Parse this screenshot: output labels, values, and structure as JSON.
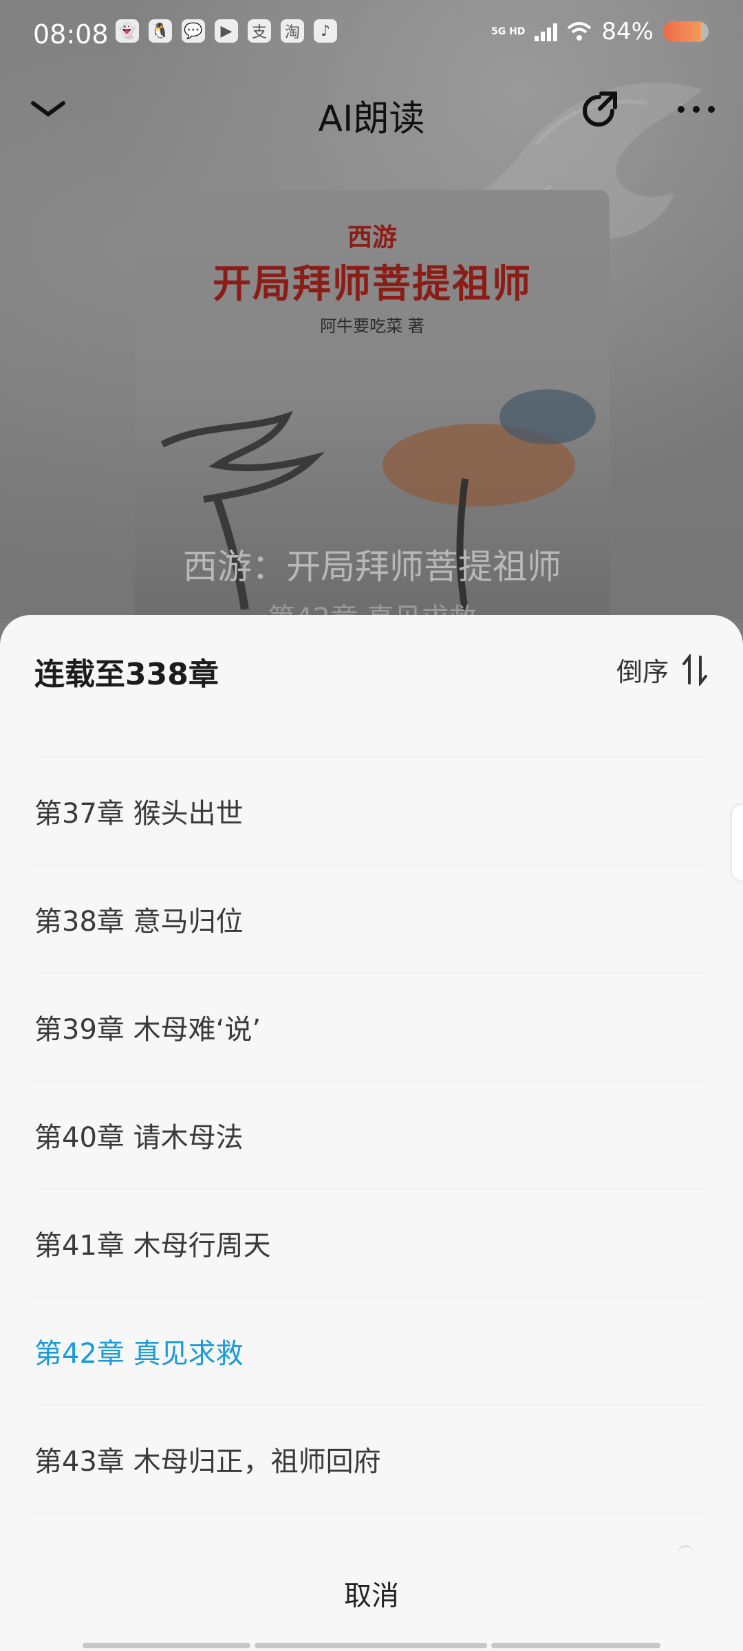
{
  "status_bar": {
    "time": "08:08",
    "app_icons": [
      "ghost-icon",
      "qq-icon",
      "wechat-icon",
      "alipay-icon",
      "pay-icon",
      "taobao-icon",
      "tiktok-icon"
    ],
    "app_glyphs": [
      "👻",
      "🐧",
      "💬",
      "▶",
      "支",
      "淘",
      "♪"
    ],
    "network": "5G HD",
    "battery_text": "84%",
    "battery_level": 0.84
  },
  "top_nav": {
    "title": "AI朗读"
  },
  "cover": {
    "small_title": "西游",
    "main_title": "开局拜师菩提祖师",
    "author": "阿牛要吃菜 著",
    "overlay_title": "西游：开局拜师菩提祖师",
    "overlay_subtitle": "第42章 真见求救"
  },
  "sheet": {
    "serial_status": "连载至338章",
    "sort_label": "倒序",
    "chapters": [
      {
        "label": "第37章 猴头出世",
        "current": false
      },
      {
        "label": "第38章 意马归位",
        "current": false
      },
      {
        "label": "第39章 木母难‘说’",
        "current": false
      },
      {
        "label": "第40章 请木母法",
        "current": false
      },
      {
        "label": "第41章 木母行周天",
        "current": false
      },
      {
        "label": "第42章 真见求救",
        "current": true
      },
      {
        "label": "第43章 木母归正，祖师回府",
        "current": false
      }
    ],
    "cancel_label": "取消"
  },
  "colors": {
    "current_chapter": "#1a9bd7",
    "sheet_background": "#f7f7f7",
    "cover_title_red": "#8b1d16"
  }
}
